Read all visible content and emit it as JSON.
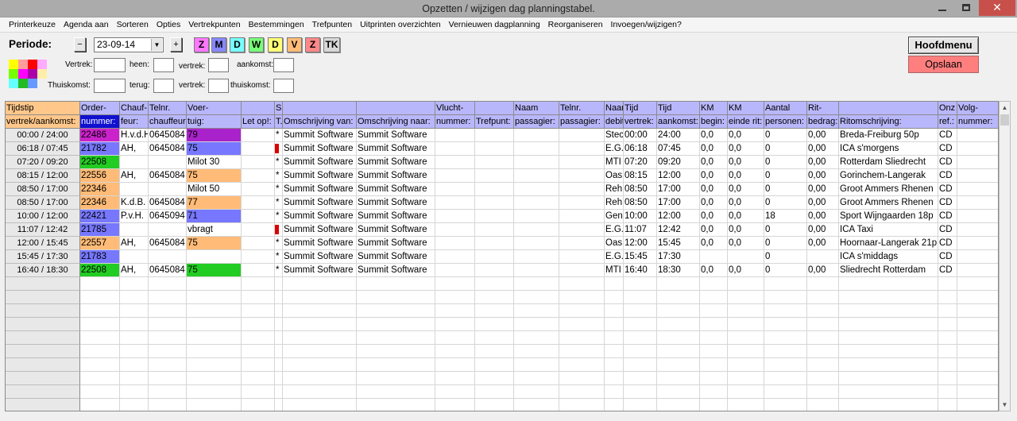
{
  "window": {
    "title": "Opzetten / wijzigen dag planningstabel.",
    "close_glyph": "✕"
  },
  "menu": [
    "Printerkeuze",
    "Agenda aan",
    "Sorteren",
    "Opties",
    "Vertrekpunten",
    "Bestemmingen",
    "Trefpunten",
    "Uitprinten overzichten",
    "Vernieuwen dagplanning",
    "Reorganiseren",
    "Invoegen/wijzigen?"
  ],
  "periode": {
    "label": "Periode:",
    "prev_symbol": "−",
    "date": "23-09-14",
    "next_symbol": "+",
    "day_buttons": [
      {
        "label": "Z",
        "color": "#ff77ff"
      },
      {
        "label": "M",
        "color": "#8888ff"
      },
      {
        "label": "D",
        "color": "#77ffff"
      },
      {
        "label": "W",
        "color": "#77ff77"
      },
      {
        "label": "D",
        "color": "#ffff77"
      },
      {
        "label": "V",
        "color": "#ffbb77"
      },
      {
        "label": "Z",
        "color": "#ff8888"
      },
      {
        "label": "TK",
        "color": "#d8d8d8"
      }
    ]
  },
  "swatch_colors": [
    "#ffff00",
    "#ff9c9c",
    "#ff0000",
    "#ffaaff",
    "#77ff00",
    "#ff00ff",
    "#aa00aa",
    "#ffeeaa",
    "#66ffff",
    "#22bb22",
    "#6699ff"
  ],
  "fields": {
    "vertrek": "Vertrek:",
    "heen": "heen:",
    "vertrek2": "vertrek:",
    "aankomst": "aankomst:",
    "thuiskomst": "Thuiskomst:",
    "terug": "terug:",
    "vertrek3": "vertrek:",
    "thuiskomst2": "thuiskomst:"
  },
  "buttons": {
    "hoofdmenu": "Hoofdmenu",
    "opslaan": "Opslaan"
  },
  "grid": {
    "header_top": [
      "Tijdstip",
      "Order-",
      "Chauf-",
      "Telnr.",
      "Voer-",
      "",
      "S",
      "",
      "",
      "Vlucht-",
      "",
      "Naam",
      "Telnr.",
      "Naam",
      "Tijd",
      "Tijd",
      "KM",
      "KM",
      "Aantal",
      "Rit-",
      "",
      "Onz",
      "Volg-"
    ],
    "header_bottom": [
      "vertrek/aankomst:",
      "nummer:",
      "feur:",
      "chauffeur:",
      "tuig:",
      "Let op!:",
      "T.",
      "Omschrijving van:",
      "Omschrijving naar:",
      "nummer:",
      "Trefpunt:",
      "passagier:",
      "passagier:",
      "debit",
      "vertrek:",
      "aankomst:",
      "begin:",
      "einde rit:",
      "personen:",
      "bedrag:",
      "Ritomschrijving:",
      "ref.:",
      "nummer:"
    ],
    "rows": [
      {
        "time": "00:00 / 24:00",
        "order": "22486",
        "order_color": "#cc22cc",
        "chauffeur": "H.v.d.H.",
        "telnr": "0645084",
        "voertuig": "79",
        "voertuig_color": "#aa22cc",
        "s": "*",
        "s_color": "",
        "van": "Summit Software",
        "naar": "Summit Software",
        "naam": "Stec",
        "tv": "00:00",
        "ta": "24:00",
        "kmb": "0,0",
        "kme": "0,0",
        "pers": "0",
        "bedrag": "0,00",
        "rit": "Breda-Freiburg 50p",
        "onz": "CD"
      },
      {
        "time": "06:18 / 07:45",
        "order": "21782",
        "order_color": "#7777ff",
        "chauffeur": "AH,",
        "telnr": "0645084",
        "voertuig": "75",
        "voertuig_color": "#7777ff",
        "s": "*",
        "s_color": "#dd0000",
        "van": "Summit Software",
        "naar": "Summit Software",
        "naam": "E.G.",
        "tv": "06:18",
        "ta": "07:45",
        "kmb": "0,0",
        "kme": "0,0",
        "pers": "0",
        "bedrag": "0,00",
        "rit": "ICA s'morgens",
        "onz": "CD"
      },
      {
        "time": "07:20 / 09:20",
        "order": "22508",
        "order_color": "#22cc22",
        "chauffeur": "",
        "telnr": "",
        "voertuig": "Milot 30",
        "voertuig_color": "",
        "s": "*",
        "s_color": "",
        "van": "Summit Software",
        "naar": "Summit Software",
        "naam": "MTI",
        "tv": "07:20",
        "ta": "09:20",
        "kmb": "0,0",
        "kme": "0,0",
        "pers": "0",
        "bedrag": "0,00",
        "rit": "Rotterdam Sliedrecht",
        "onz": "CD"
      },
      {
        "time": "08:15 / 12:00",
        "order": "22556",
        "order_color": "#ffbb77",
        "chauffeur": "AH,",
        "telnr": "0645084",
        "voertuig": "75",
        "voertuig_color": "#ffbb77",
        "s": "*",
        "s_color": "",
        "van": "Summit Software",
        "naar": "Summit Software",
        "naam": "Oas",
        "tv": "08:15",
        "ta": "12:00",
        "kmb": "0,0",
        "kme": "0,0",
        "pers": "0",
        "bedrag": "0,00",
        "rit": "Gorinchem-Langerak",
        "onz": "CD"
      },
      {
        "time": "08:50 / 17:00",
        "order": "22346",
        "order_color": "#ffbb77",
        "chauffeur": "",
        "telnr": "",
        "voertuig": "Milot 50",
        "voertuig_color": "",
        "s": "*",
        "s_color": "",
        "van": "Summit Software",
        "naar": "Summit Software",
        "naam": "Reh",
        "tv": "08:50",
        "ta": "17:00",
        "kmb": "0,0",
        "kme": "0,0",
        "pers": "0",
        "bedrag": "0,00",
        "rit": "Groot Ammers Rhenen",
        "onz": "CD"
      },
      {
        "time": "08:50 / 17:00",
        "order": "22346",
        "order_color": "#ffbb77",
        "chauffeur": "K.d.B.",
        "telnr": "0645084",
        "voertuig": "77",
        "voertuig_color": "#ffbb77",
        "s": "*",
        "s_color": "",
        "van": "Summit Software",
        "naar": "Summit Software",
        "naam": "Reh",
        "tv": "08:50",
        "ta": "17:00",
        "kmb": "0,0",
        "kme": "0,0",
        "pers": "0",
        "bedrag": "0,00",
        "rit": "Groot Ammers Rhenen",
        "onz": "CD"
      },
      {
        "time": "10:00 / 12:00",
        "order": "22421",
        "order_color": "#7777ff",
        "chauffeur": "P.v.H.",
        "telnr": "0645094",
        "voertuig": "71",
        "voertuig_color": "#7777ff",
        "s": "*",
        "s_color": "",
        "van": "Summit Software",
        "naar": "Summit Software",
        "naam": "Gen",
        "tv": "10:00",
        "ta": "12:00",
        "kmb": "0,0",
        "kme": "0,0",
        "pers": "18",
        "bedrag": "0,00",
        "rit": "Sport Wijngaarden 18p",
        "onz": "CD"
      },
      {
        "time": "11:07 / 12:42",
        "order": "21785",
        "order_color": "#7777ff",
        "chauffeur": "",
        "telnr": "",
        "voertuig": "vbragt",
        "voertuig_color": "",
        "s": "*",
        "s_color": "#dd0000",
        "van": "Summit Software",
        "naar": "Summit Software",
        "naam": "E.G.",
        "tv": "11:07",
        "ta": "12:42",
        "kmb": "0,0",
        "kme": "0,0",
        "pers": "0",
        "bedrag": "0,00",
        "rit": "ICA Taxi",
        "onz": "CD"
      },
      {
        "time": "12:00 / 15:45",
        "order": "22557",
        "order_color": "#ffbb77",
        "chauffeur": "AH,",
        "telnr": "0645084",
        "voertuig": "75",
        "voertuig_color": "#ffbb77",
        "s": "*",
        "s_color": "",
        "van": "Summit Software",
        "naar": "Summit Software",
        "naam": "Oas",
        "tv": "12:00",
        "ta": "15:45",
        "kmb": "0,0",
        "kme": "0,0",
        "pers": "0",
        "bedrag": "0,00",
        "rit": "Hoornaar-Langerak 21p",
        "onz": "CD"
      },
      {
        "time": "15:45 / 17:30",
        "order": "21783",
        "order_color": "#7777ff",
        "chauffeur": "",
        "telnr": "",
        "voertuig": "",
        "voertuig_color": "",
        "s": "*",
        "s_color": "",
        "van": "Summit Software",
        "naar": "Summit Software",
        "naam": "E.G.",
        "tv": "15:45",
        "ta": "17:30",
        "kmb": "",
        "kme": "",
        "pers": "0",
        "bedrag": "",
        "rit": "ICA s'middags",
        "onz": "CD"
      },
      {
        "time": "16:40 / 18:30",
        "order": "22508",
        "order_color": "#22cc22",
        "chauffeur": "AH,",
        "telnr": "0645084",
        "voertuig": "75",
        "voertuig_color": "#22cc22",
        "s": "*",
        "s_color": "",
        "van": "Summit Software",
        "naar": "Summit Software",
        "naam": "MTI",
        "tv": "16:40",
        "ta": "18:30",
        "kmb": "0,0",
        "kme": "0,0",
        "pers": "0",
        "bedrag": "0,00",
        "rit": "Sliedrecht  Rotterdam",
        "onz": "CD"
      }
    ],
    "empty_rows": 10
  },
  "scrollbar": {
    "up_symbol": "▲",
    "down_symbol": "▼"
  }
}
